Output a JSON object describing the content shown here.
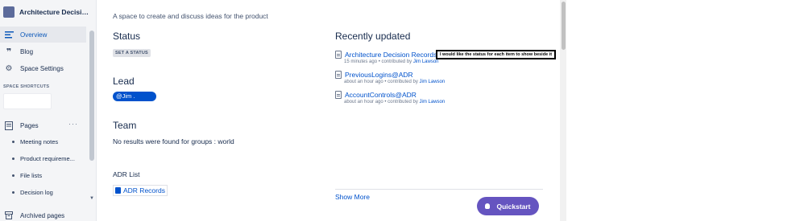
{
  "sidebar": {
    "space_title": "Architecture Decision R...",
    "nav": [
      {
        "label": "Overview",
        "icon": "overview-icon",
        "active": true
      },
      {
        "label": "Blog",
        "icon": "quote-icon"
      },
      {
        "label": "Space Settings",
        "icon": "gear-icon"
      }
    ],
    "shortcuts_label": "SPACE SHORTCUTS",
    "pages_label": "Pages",
    "pages_menu": "···",
    "tree": [
      "Meeting notes",
      "Product requireme...",
      "File lists",
      "Decision log"
    ],
    "archived_label": "Archived pages"
  },
  "main": {
    "description": "A space to create and discuss ideas for the product",
    "status": {
      "heading": "Status",
      "lozenge": "SET A STATUS"
    },
    "lead": {
      "heading": "Lead",
      "mention": "@Jim ."
    },
    "team": {
      "heading": "Team",
      "text": "No results were found for groups : world"
    },
    "adr": {
      "heading": "ADR List",
      "link": "ADR Records"
    },
    "recent": {
      "heading": "Recently updated",
      "items": [
        {
          "title": "Architecture Decision Records",
          "time": "15 minutes ago • contributed by ",
          "who": "Jim Lawson"
        },
        {
          "title": "PreviousLogins@ADR",
          "time": "about an hour ago • contributed by ",
          "who": "Jim Lawson"
        },
        {
          "title": "AccountControls@ADR",
          "time": "about an hour ago • contributed by ",
          "who": "Jim Lawson"
        }
      ],
      "show_more": "Show More"
    },
    "callout": "I would like the status for each item to show beside it",
    "quickstart": "Quickstart"
  },
  "colors": {
    "accent": "#0052cc",
    "quickstart": "#6554c0",
    "sidebar_bg": "#f4f5f7"
  }
}
